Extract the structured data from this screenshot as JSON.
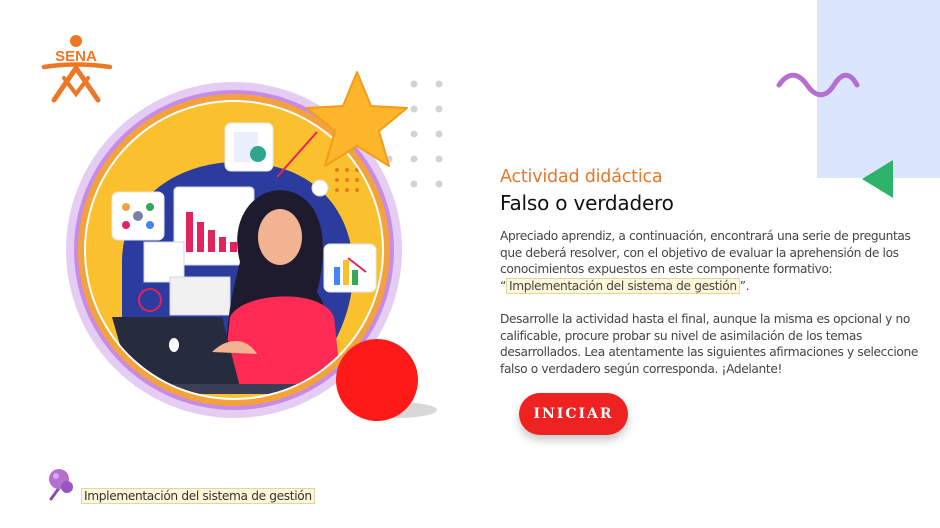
{
  "brand": {
    "logo_text": "SENA",
    "accent_color": "#e8762b"
  },
  "header": {
    "eyebrow": "Actividad didáctica",
    "title": "Falso o verdadero"
  },
  "intro": {
    "p1_part1": "Apreciado aprendiz, a continuación, encontrará una serie de preguntas que deberá resolver, con el objetivo de evaluar la aprehensión de los conocimientos expuestos en este componente formativo: “",
    "p1_highlight": "Implementación del sistema de gestión",
    "p1_part2": "”.",
    "p2": "Desarrolle la actividad hasta el final, aunque la misma es opcional y no calificable, procure probar su nivel de asimilación de los temas desarrollados.  Lea atentamente las siguientes afirmaciones y seleccione falso o verdadero según corresponda. ¡Adelante!"
  },
  "actions": {
    "start_label": "INICIAR",
    "start_color": "#ef2222"
  },
  "footer": {
    "component_label": "Implementación del sistema de gestión",
    "pin_icon": "pushpin-icon"
  },
  "decor": {
    "triangle_color": "#2db36a",
    "squiggle_color": "#b56fd0",
    "panel_color": "#dbe5fb"
  }
}
